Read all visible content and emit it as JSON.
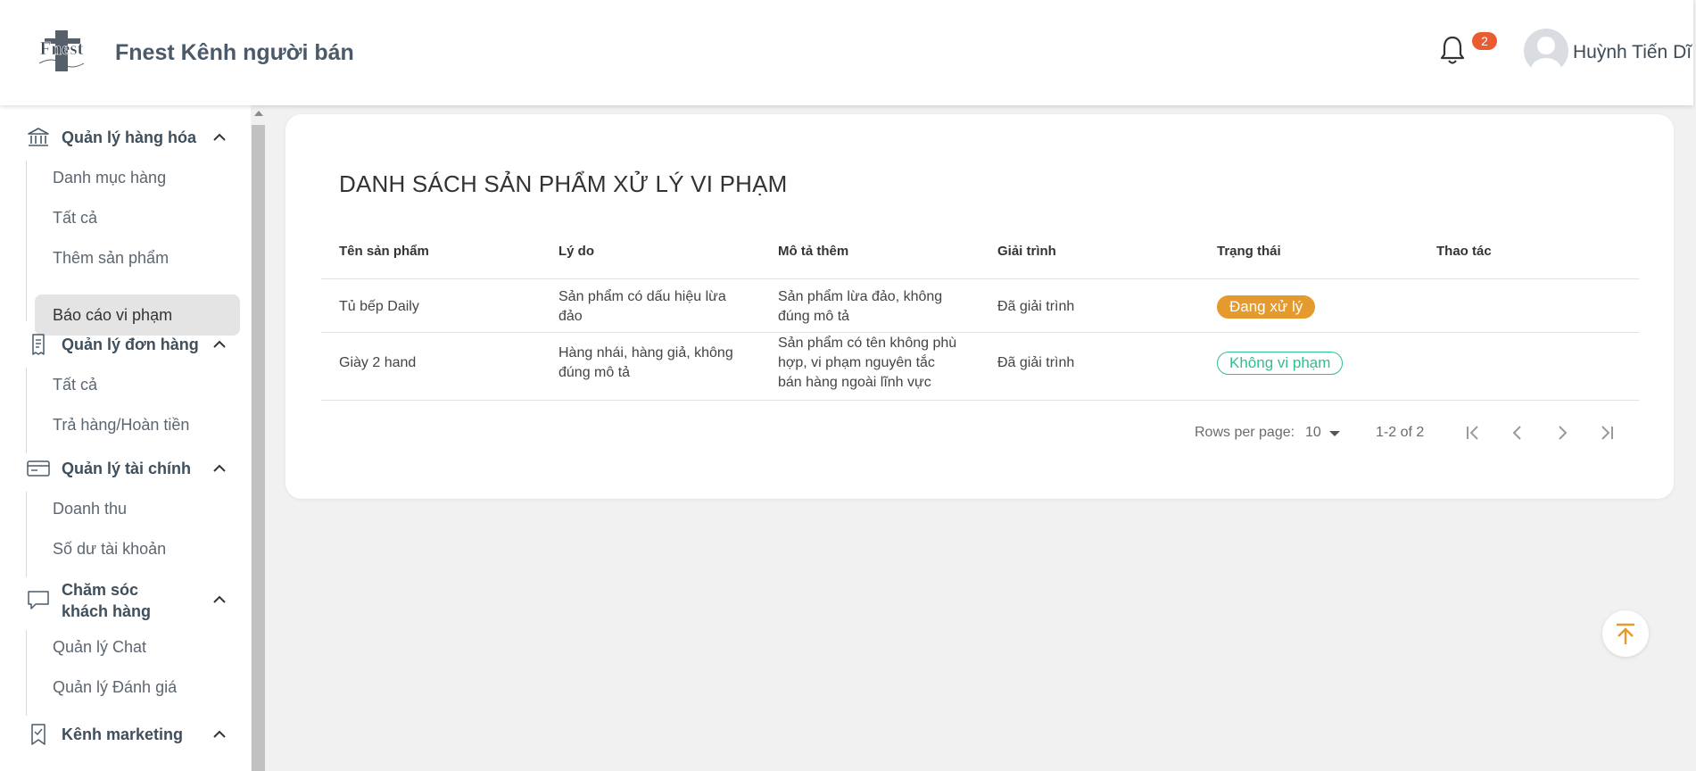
{
  "header": {
    "brand_title": "Fnest Kênh người bán",
    "notification_count": "2",
    "user_name": "Huỳnh Tiến Dĩ"
  },
  "sidebar": {
    "groups": [
      {
        "label": "Quản lý hàng hóa",
        "icon": "bank-icon",
        "items": [
          {
            "label": "Danh mục hàng"
          },
          {
            "label": "Tất cả"
          },
          {
            "label": "Thêm sản phẩm"
          },
          {
            "label": "Báo cáo vi phạm",
            "active": true
          }
        ]
      },
      {
        "label": "Quản lý đơn hàng",
        "icon": "receipt-icon",
        "items": [
          {
            "label": "Tất cả"
          },
          {
            "label": "Trả hàng/Hoàn tiền"
          }
        ]
      },
      {
        "label": "Quản lý tài chính",
        "icon": "card-icon",
        "items": [
          {
            "label": "Doanh thu"
          },
          {
            "label": "Số dư tài khoản"
          }
        ]
      },
      {
        "label_line1": "Chăm sóc",
        "label_line2": "khách hàng",
        "icon": "chat-icon",
        "items": [
          {
            "label": "Quản lý Chat"
          },
          {
            "label": "Quản lý Đánh giá"
          }
        ]
      },
      {
        "label": "Kênh marketing",
        "icon": "bookmark-icon",
        "items": []
      }
    ]
  },
  "main": {
    "title": "DANH SÁCH SẢN PHẨM XỬ LÝ VI PHẠM",
    "columns": [
      "Tên sản phẩm",
      "Lý do",
      "Mô tả thêm",
      "Giải trình",
      "Trạng thái",
      "Thao tác"
    ],
    "rows": [
      {
        "name": "Tủ bếp Daily",
        "reason_line1": "Sản phẩm có dấu hiệu lừa",
        "reason_line2": "đảo",
        "desc_line1": "Sản phẩm lừa đảo, không",
        "desc_line2": "đúng mô tả",
        "explain": "Đã giải trình",
        "status": "Đang xử lý",
        "status_color": "#e49a2c"
      },
      {
        "name": "Giày 2 hand",
        "reason_line1": "Hàng nhái, hàng giả, không",
        "reason_line2": "đúng mô tả",
        "desc_line1": "Sản phẩm có tên không phù",
        "desc_line2": "hợp, vi phạm nguyên tắc",
        "desc_line3": "bán hàng ngoài lĩnh vực",
        "explain": "Đã giải trình",
        "status": "Không vi phạm",
        "status_color": "#2fbf91"
      }
    ],
    "pagination": {
      "rows_per_page_label": "Rows per page:",
      "rows_per_page_value": "10",
      "range": "1-2 of 2"
    }
  },
  "icons": {
    "notification": "bell-icon",
    "scroll_top": "arrow-up-to-top-icon",
    "first_page": "first-page-icon",
    "prev_page": "chevron-left-icon",
    "next_page": "chevron-right-icon",
    "last_page": "last-page-icon"
  }
}
